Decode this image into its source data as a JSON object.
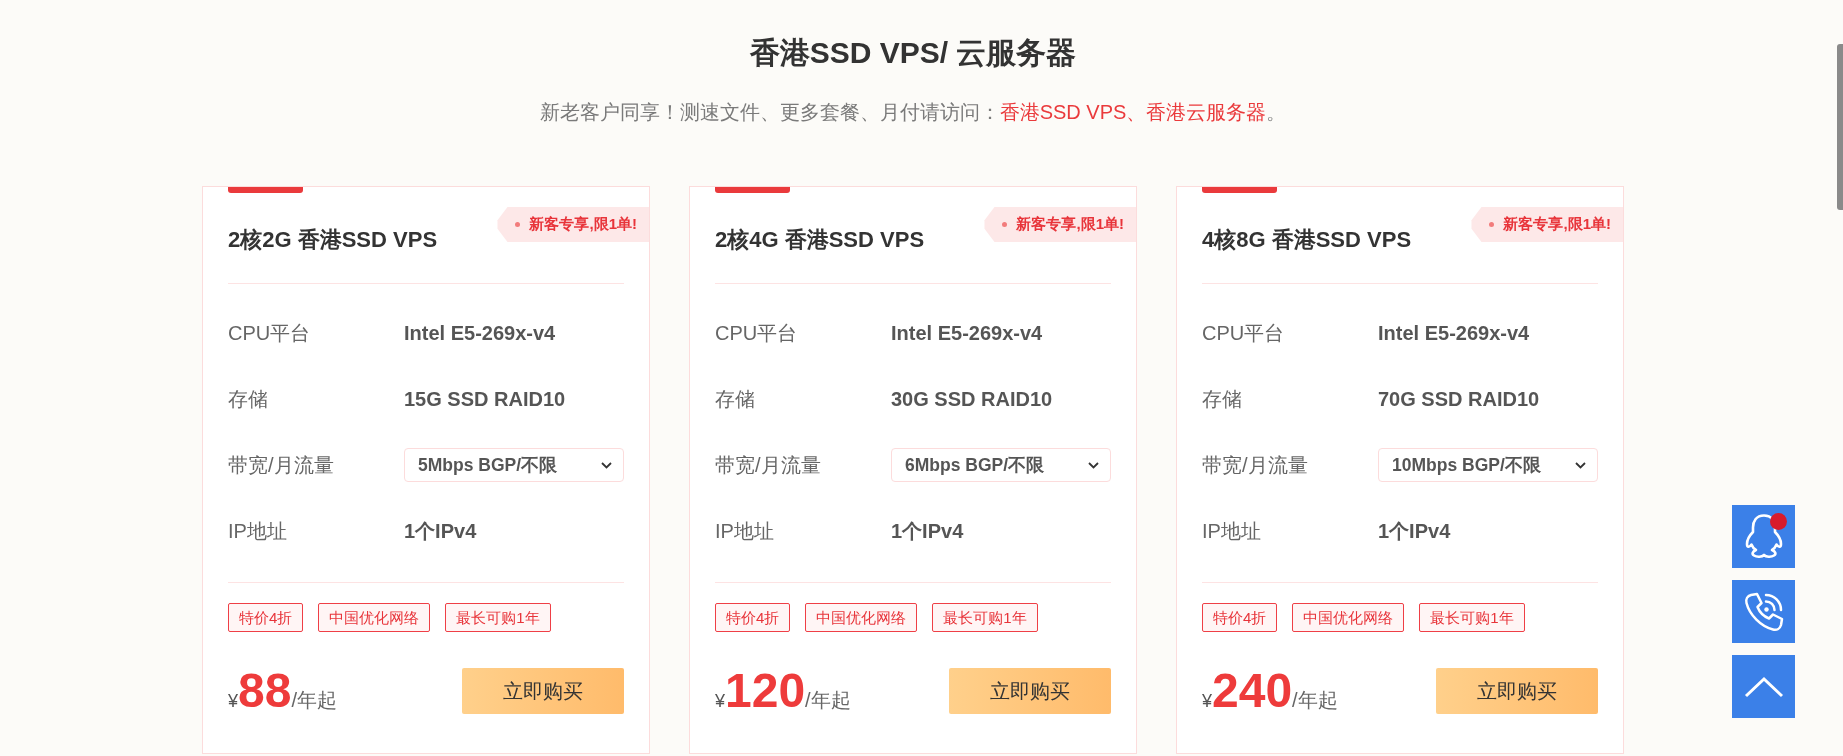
{
  "header": {
    "title": "香港SSD VPS/ 云服务器",
    "subtitle": [
      {
        "kind": "text",
        "text": "新老客户同享！测速文件、更多套餐、月付请访问："
      },
      {
        "kind": "link",
        "text": "香港SSD VPS"
      },
      {
        "kind": "accent",
        "text": "、"
      },
      {
        "kind": "link",
        "text": "香港云服务器"
      },
      {
        "kind": "text",
        "text": "。"
      }
    ]
  },
  "plans": [
    {
      "title": "2核2G 香港SSD VPS",
      "badge": "新客专享,限1单!",
      "specs": [
        {
          "kind": "text",
          "label": "CPU平台",
          "value": "Intel E5-269x-v4"
        },
        {
          "kind": "text",
          "label": "存储",
          "value": "15G SSD RAID10"
        },
        {
          "kind": "select",
          "label": "带宽/月流量",
          "value": "5Mbps BGP/不限"
        },
        {
          "kind": "text",
          "label": "IP地址",
          "value": "1个IPv4"
        }
      ],
      "tags": [
        "特价4折",
        "中国优化网络",
        "最长可购1年"
      ],
      "currency": "¥",
      "price": "88",
      "price_unit": "/年起",
      "button": "立即购买"
    },
    {
      "title": "2核4G 香港SSD VPS",
      "badge": "新客专享,限1单!",
      "specs": [
        {
          "kind": "text",
          "label": "CPU平台",
          "value": "Intel E5-269x-v4"
        },
        {
          "kind": "text",
          "label": "存储",
          "value": "30G SSD RAID10"
        },
        {
          "kind": "select",
          "label": "带宽/月流量",
          "value": "6Mbps BGP/不限"
        },
        {
          "kind": "text",
          "label": "IP地址",
          "value": "1个IPv4"
        }
      ],
      "tags": [
        "特价4折",
        "中国优化网络",
        "最长可购1年"
      ],
      "currency": "¥",
      "price": "120",
      "price_unit": "/年起",
      "button": "立即购买"
    },
    {
      "title": "4核8G 香港SSD VPS",
      "badge": "新客专享,限1单!",
      "specs": [
        {
          "kind": "text",
          "label": "CPU平台",
          "value": "Intel E5-269x-v4"
        },
        {
          "kind": "text",
          "label": "存储",
          "value": "70G SSD RAID10"
        },
        {
          "kind": "select",
          "label": "带宽/月流量",
          "value": "10Mbps BGP/不限"
        },
        {
          "kind": "text",
          "label": "IP地址",
          "value": "1个IPv4"
        }
      ],
      "tags": [
        "特价4折",
        "中国优化网络",
        "最长可购1年"
      ],
      "currency": "¥",
      "price": "240",
      "price_unit": "/年起",
      "button": "立即购买"
    }
  ],
  "float_buttons": [
    {
      "kind": "chat",
      "notification": true
    },
    {
      "kind": "phone",
      "notification": false
    },
    {
      "kind": "top",
      "notification": false
    }
  ]
}
